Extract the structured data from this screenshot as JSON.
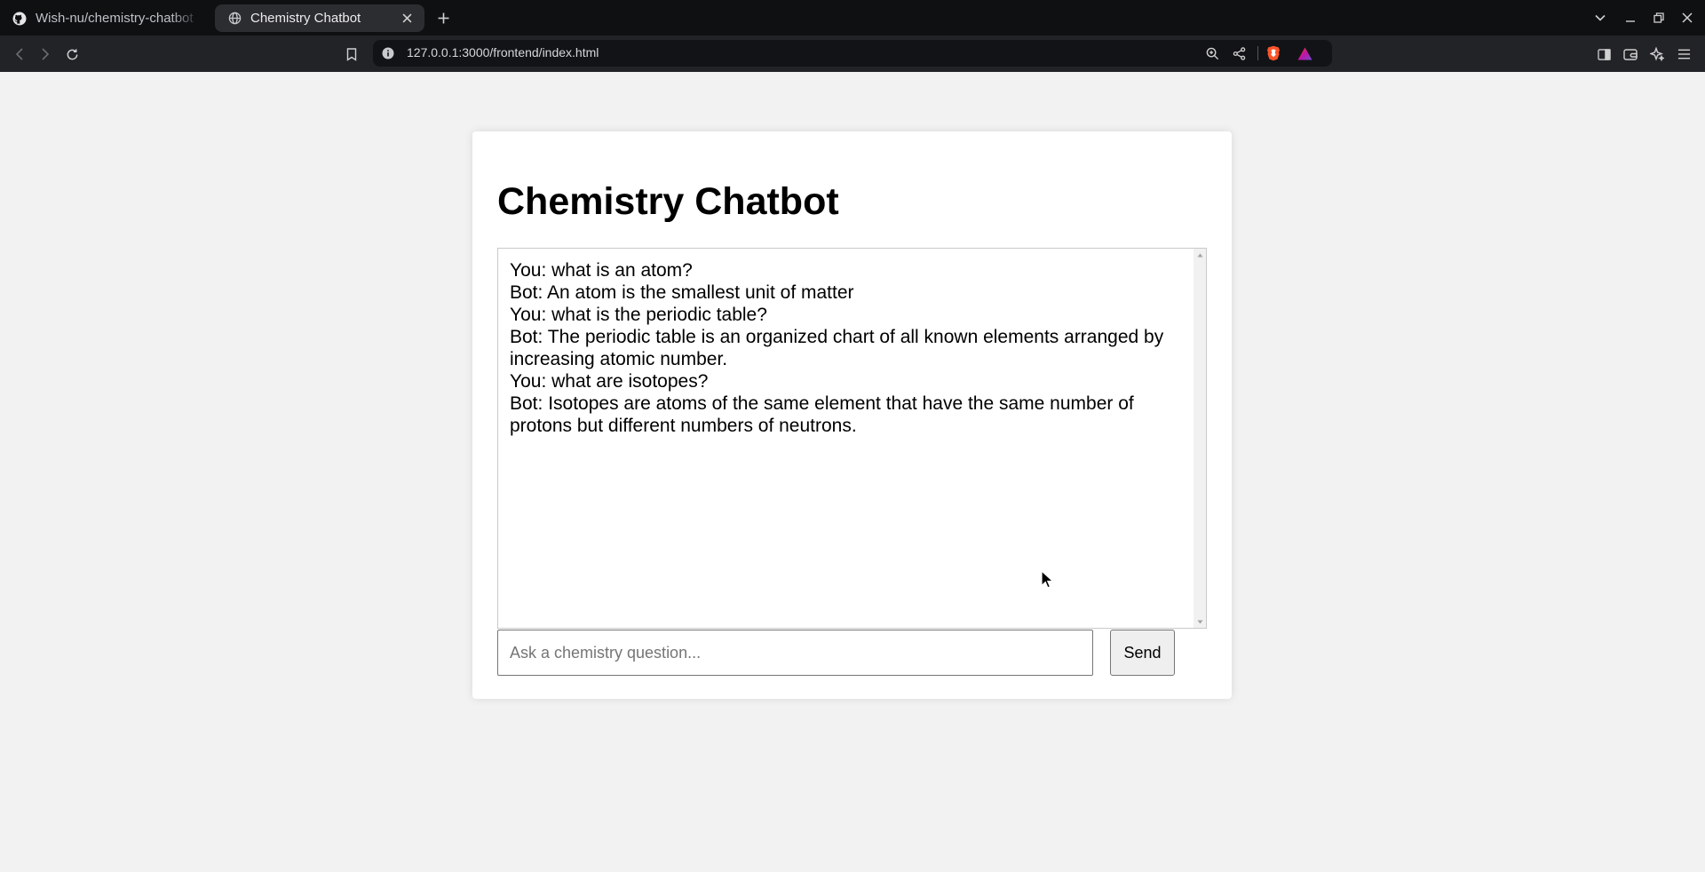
{
  "browser": {
    "tabs": [
      {
        "title": "Wish-nu/chemistry-chatbot",
        "active": false,
        "icon": "github-icon"
      },
      {
        "title": "Chemistry Chatbot",
        "active": true,
        "icon": "globe-icon"
      }
    ],
    "url": "127.0.0.1:3000/frontend/index.html",
    "colors": {
      "tabbar": "#0f1012",
      "toolbar": "#222327",
      "urlbar": "#121316"
    }
  },
  "page": {
    "title": "Chemistry Chatbot",
    "messages": [
      "You: what is an atom?",
      "Bot: An atom is the smallest unit of matter",
      "You: what is the periodic table?",
      "Bot: The periodic table is an organized chart of all known elements arranged by increasing atomic number.",
      "You: what are isotopes?",
      "Bot: Isotopes are atoms of the same element that have the same number of protons but different numbers of neutrons."
    ],
    "input": {
      "placeholder": "Ask a chemistry question...",
      "value": ""
    },
    "send_label": "Send",
    "colors": {
      "background": "#f2f2f2",
      "card": "#ffffff"
    }
  }
}
